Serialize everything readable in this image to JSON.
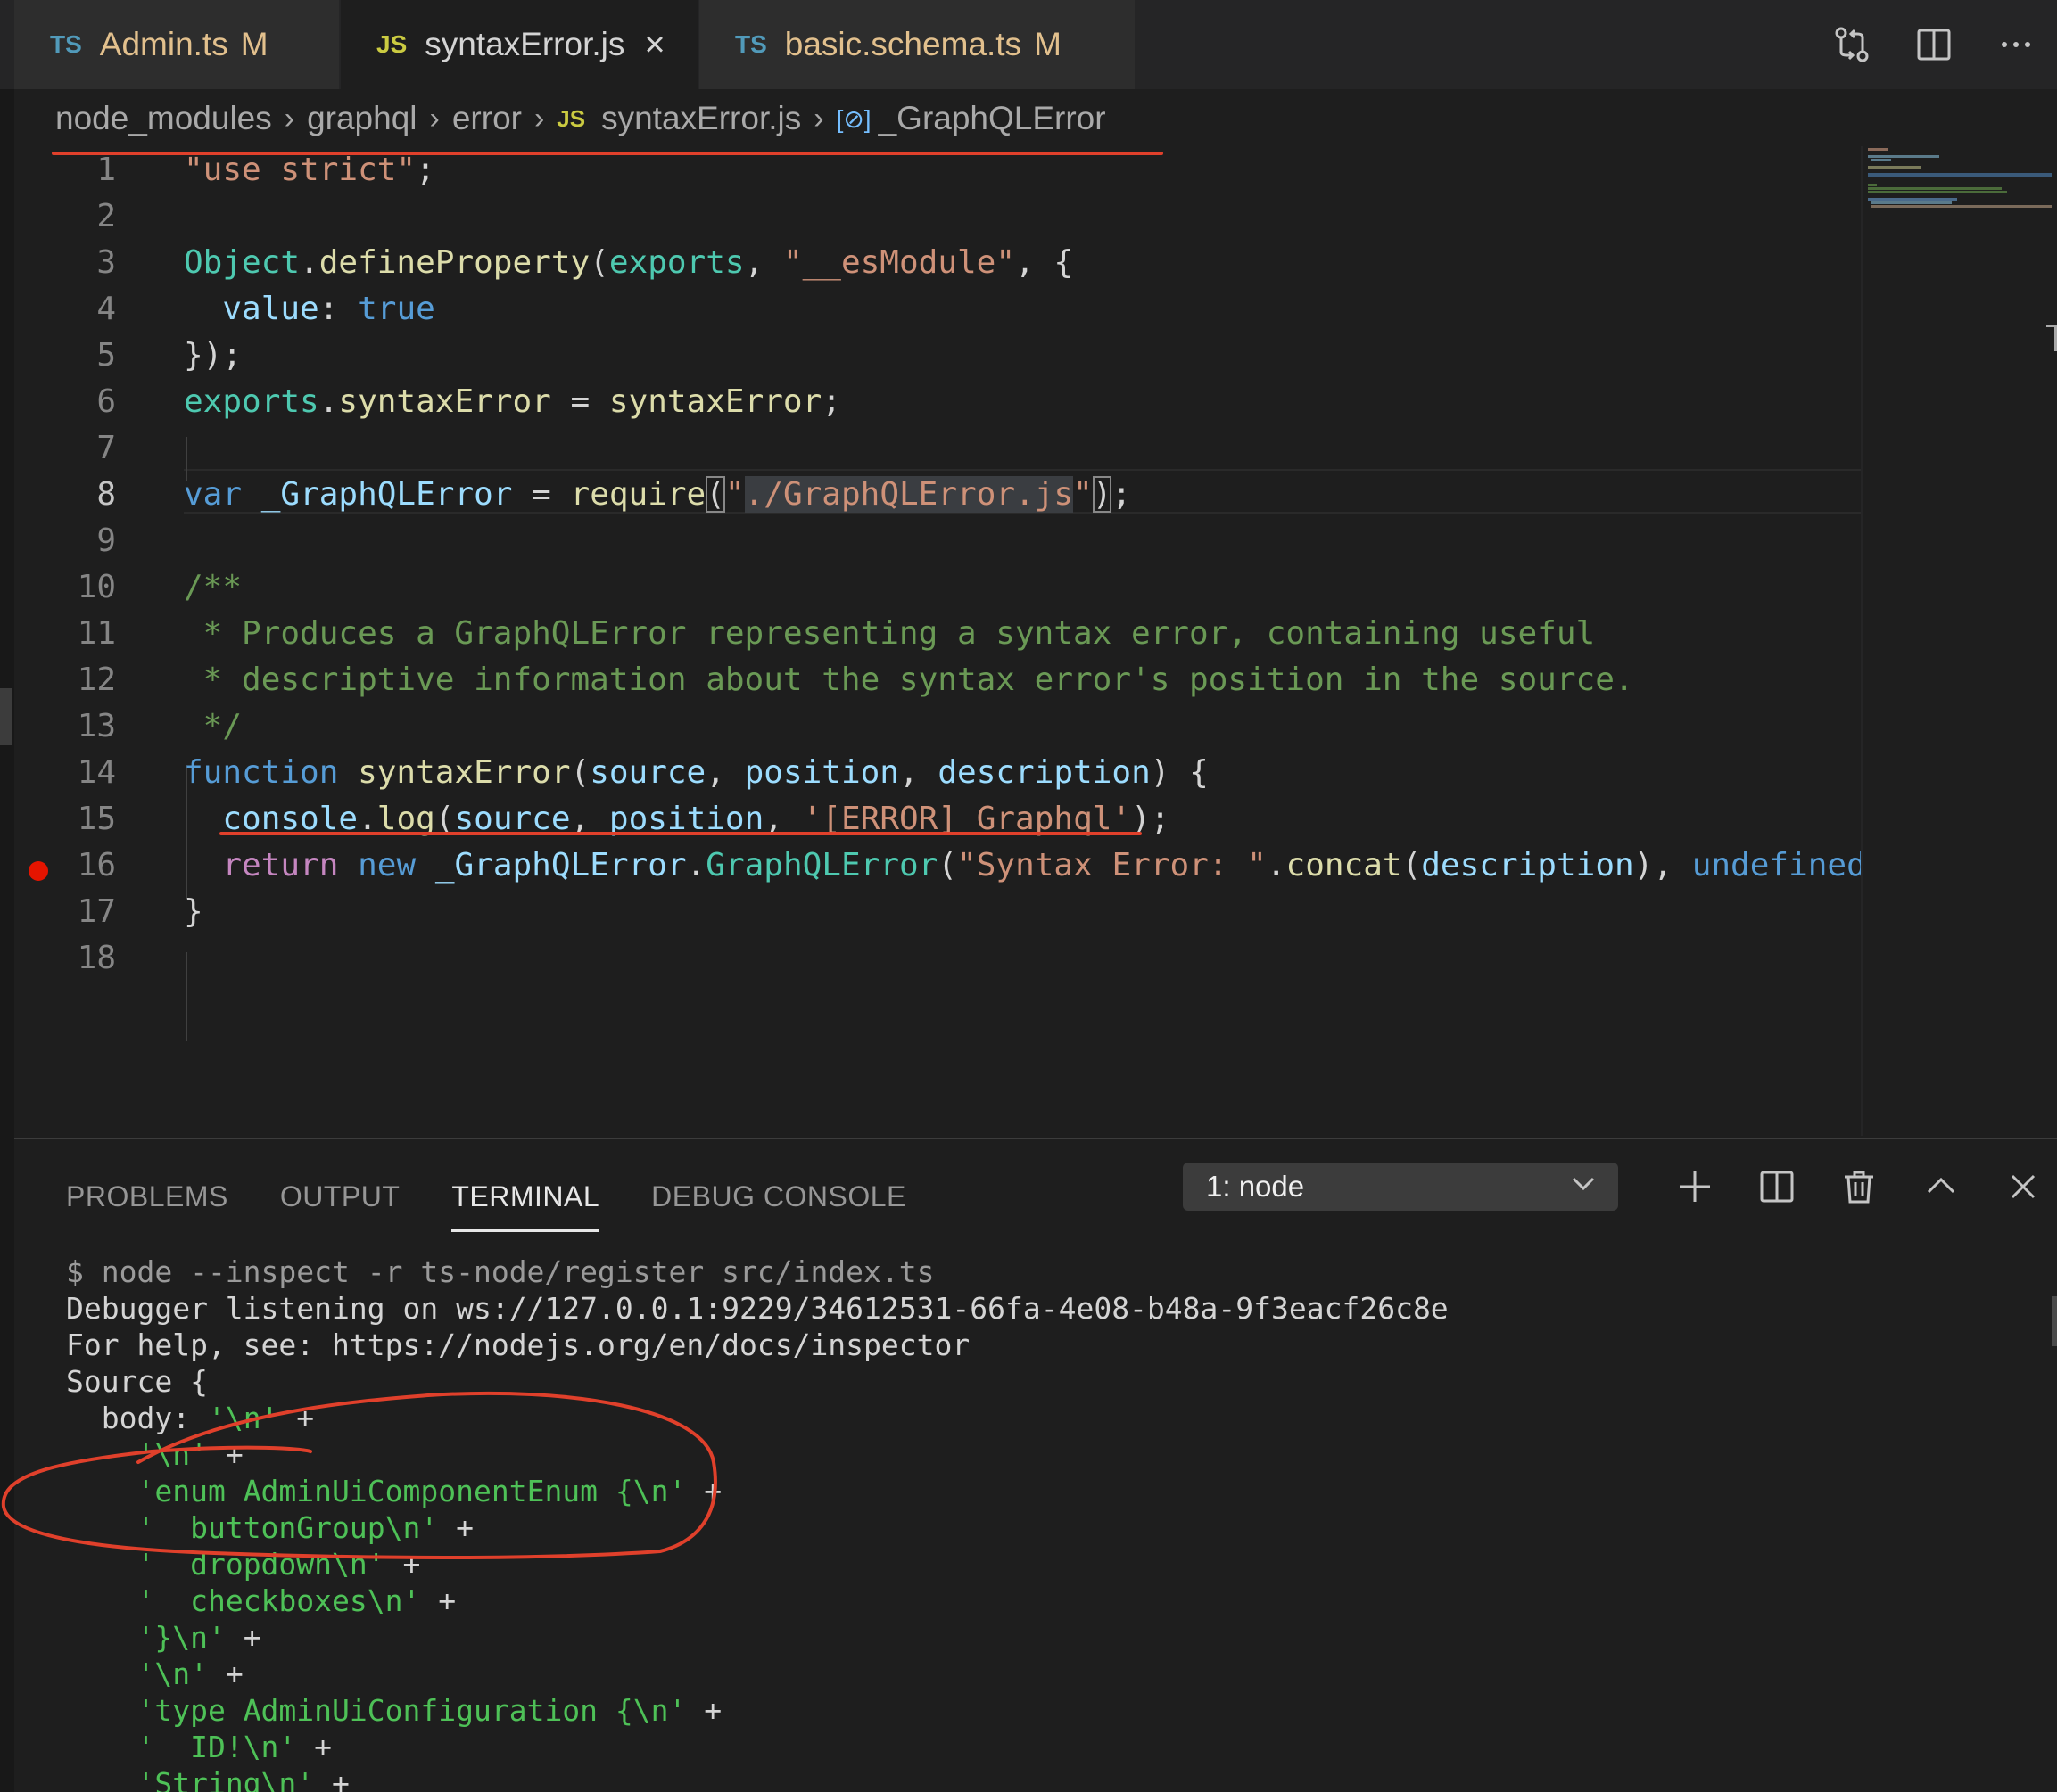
{
  "tabs": [
    {
      "lang": "TS",
      "name": "Admin.ts",
      "badge": "M"
    },
    {
      "lang": "JS",
      "name": "syntaxError.js",
      "close": "×"
    },
    {
      "lang": "TS",
      "name": "basic.schema.ts",
      "badge": "M"
    }
  ],
  "breadcrumb": {
    "items": [
      "node_modules",
      "graphql",
      "error"
    ],
    "file_lang": "JS",
    "file": "syntaxError.js",
    "symbol_icon": "[⊘]",
    "symbol": "_GraphQLError",
    "separator": "›"
  },
  "editor": {
    "line_numbers": [
      "1",
      "2",
      "3",
      "4",
      "5",
      "6",
      "7",
      "8",
      "9",
      "10",
      "11",
      "12",
      "13",
      "14",
      "15",
      "16",
      "17",
      "18"
    ],
    "current_line": "8",
    "breakpoint_line": "16"
  },
  "panel": {
    "tabs": [
      "PROBLEMS",
      "OUTPUT",
      "TERMINAL",
      "DEBUG CONSOLE"
    ],
    "active_tab": "TERMINAL",
    "terminal_select": "1: node"
  },
  "terminal": {
    "lines": [
      "$ node --inspect -r ts-node/register src/index.ts",
      "Debugger listening on ws://127.0.0.1:9229/34612531-66fa-4e08-b48a-9f3eacf26c8e",
      "For help, see: https://nodejs.org/en/docs/inspector",
      "Source {"
    ],
    "body_label": "  body: ",
    "body_parts": [
      {
        "indent": "  body: ",
        "str": "'\\n'",
        "plus": " +"
      },
      {
        "indent": "    ",
        "str": "'\\n'",
        "plus": " +"
      },
      {
        "indent": "    ",
        "str": "'enum AdminUiComponentEnum {\\n'",
        "plus": " +"
      },
      {
        "indent": "    ",
        "str": "'  buttonGroup\\n'",
        "plus": " +"
      },
      {
        "indent": "    ",
        "str": "'  dropdown\\n'",
        "plus": " +"
      },
      {
        "indent": "    ",
        "str": "'  checkboxes\\n'",
        "plus": " +"
      },
      {
        "indent": "    ",
        "str": "'}\\n'",
        "plus": " +"
      },
      {
        "indent": "    ",
        "str": "'\\n'",
        "plus": " +"
      },
      {
        "indent": "    ",
        "str": "'type AdminUiConfiguration {\\n'",
        "plus": " +"
      },
      {
        "indent": "    ",
        "str": "'  ID!\\n'",
        "plus": " +"
      },
      {
        "indent": "    ",
        "str": "'String\\n'",
        "plus": " +"
      }
    ]
  },
  "colors": {
    "annotation": "#e0402b",
    "background": "#1e1e1e",
    "keyword": "#569cd6",
    "string": "#ce9178",
    "comment": "#6a9955",
    "breakpoint": "#e51400"
  },
  "icons": {
    "compare": "compare-changes-icon",
    "split": "split-editor-icon",
    "more": "more-actions-icon",
    "add": "new-terminal-icon",
    "split_terminal": "split-terminal-icon",
    "trash": "kill-terminal-icon",
    "maximize": "maximize-panel-icon",
    "close": "close-panel-icon"
  }
}
